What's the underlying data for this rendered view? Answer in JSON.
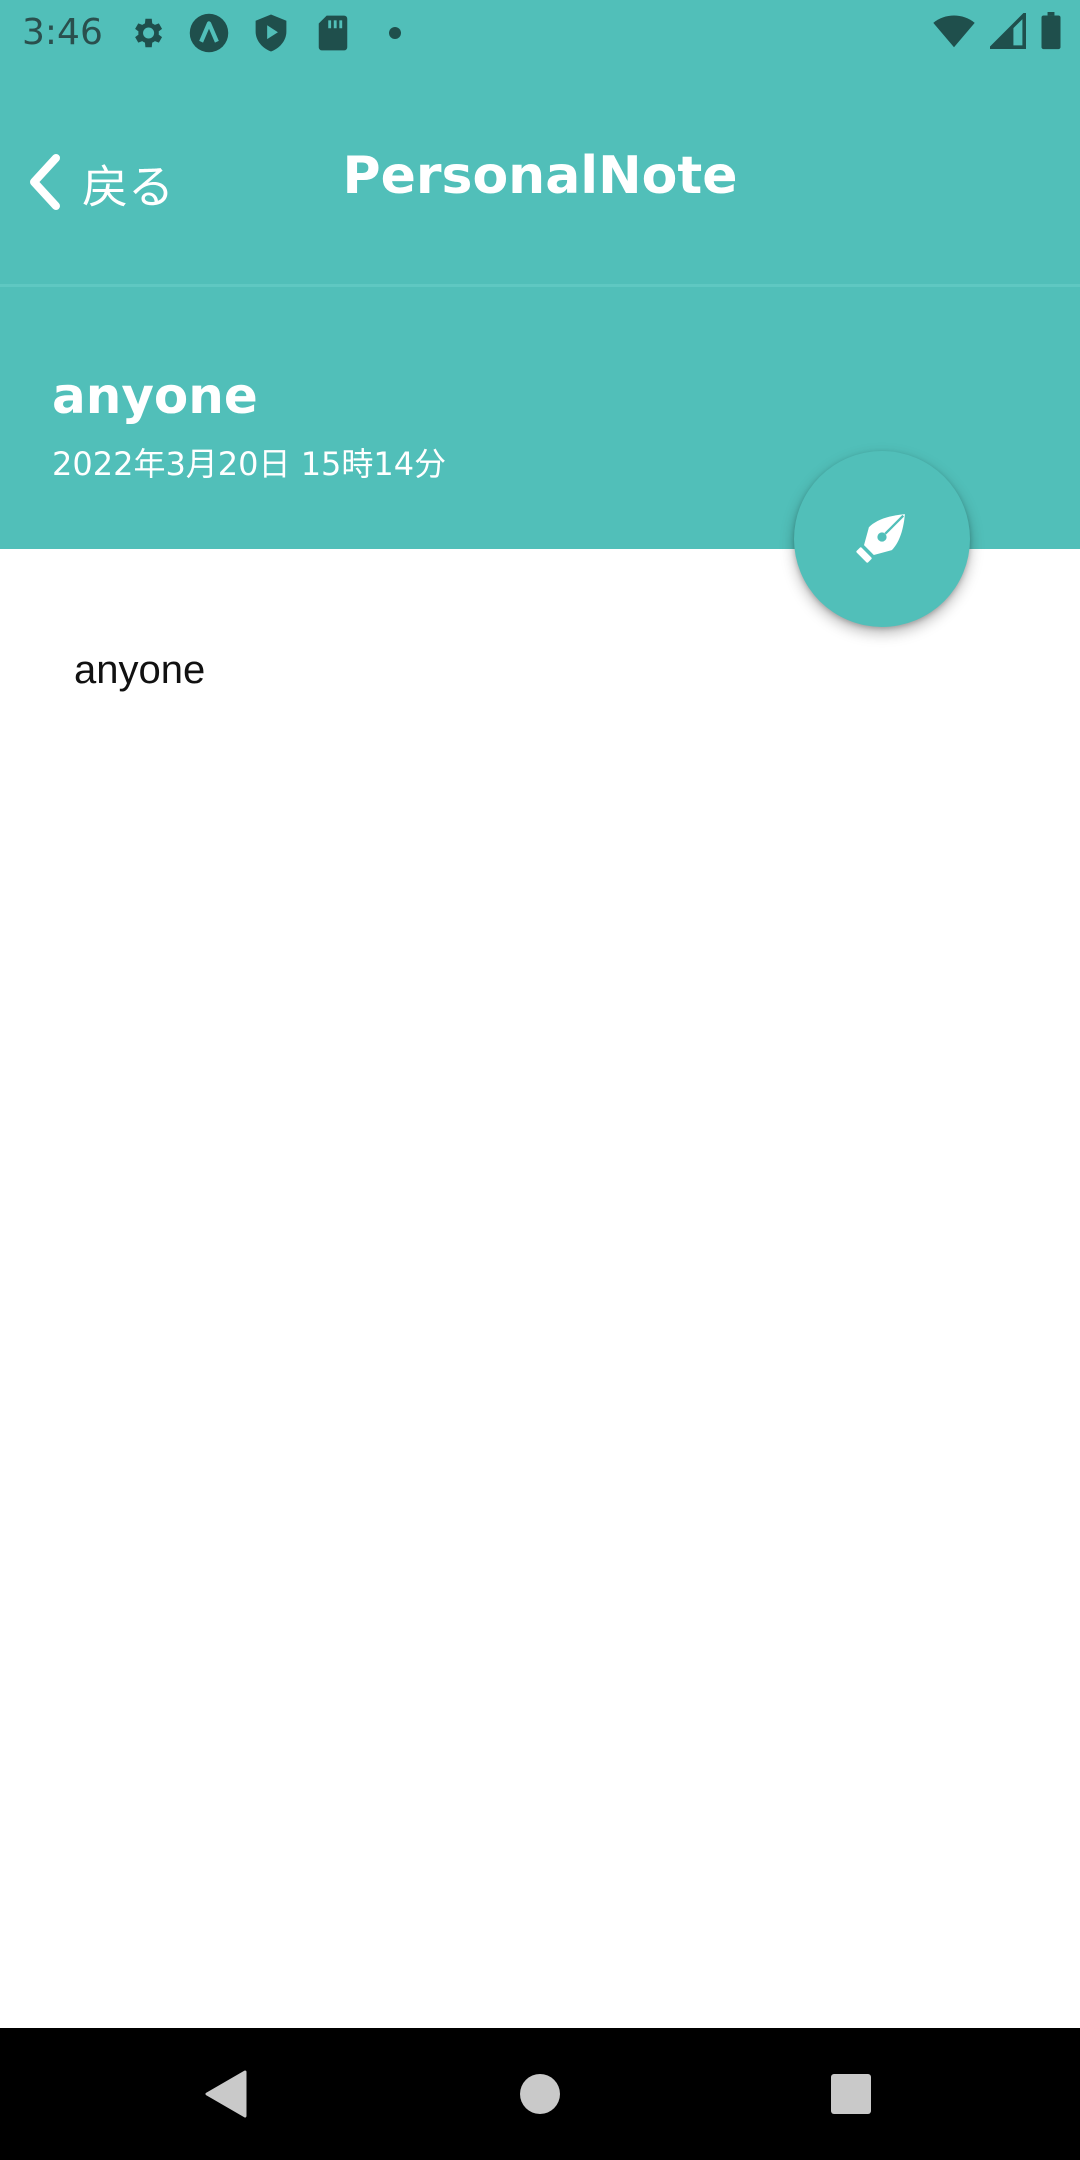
{
  "status_bar": {
    "time": "3:46",
    "left_icons": [
      "gear-icon",
      "app-a-icon",
      "shield-play-icon",
      "sd-card-icon",
      "dot-icon"
    ],
    "right_icons": [
      "wifi-icon",
      "signal-icon",
      "battery-icon"
    ]
  },
  "app_bar": {
    "back_label": "戻る",
    "title": "PersonalNote"
  },
  "note": {
    "title": "anyone",
    "date": "2022年3月20日 15時14分",
    "body": "anyone"
  },
  "fab": {
    "icon": "pen-nib-icon"
  },
  "nav_bar": {
    "buttons": [
      "back-triangle-icon",
      "home-circle-icon",
      "recents-square-icon"
    ]
  },
  "colors": {
    "primary": "#51bfb9",
    "status_icon": "#1f4f4c",
    "nav_bar": "#000000",
    "nav_icon": "#c9c9c9"
  }
}
